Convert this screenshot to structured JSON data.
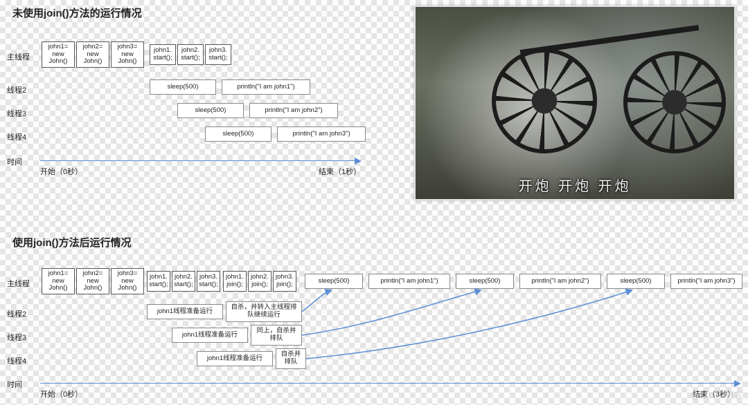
{
  "section1": {
    "title": "未使用join()方法的运行情况",
    "rows": [
      "主线程",
      "线程2",
      "线程3",
      "线程4",
      "时间"
    ],
    "main_boxes": [
      "john1=\nnew\nJohn()",
      "john2=\nnew\nJohn()",
      "john3=\nnew\nJohn()",
      "john1.\nstart();",
      "john2.\nstart();",
      "john3.\nstart();"
    ],
    "t2": {
      "sleep": "sleep(500)",
      "print": "println(\"I am john1\")"
    },
    "t3": {
      "sleep": "sleep(500)",
      "print": "println(\"I am john2\")"
    },
    "t4": {
      "sleep": "sleep(500)",
      "print": "println(\"I am john3\")"
    },
    "time_start": "开始（0秒）",
    "time_end": "结束（1秒）"
  },
  "photo": {
    "caption": "开炮 开炮 开炮"
  },
  "section2": {
    "title": "使用join()方法后运行情况",
    "rows": [
      "主线程",
      "线程2",
      "线程3",
      "线程4",
      "时间"
    ],
    "main_boxes": [
      "john1=\nnew\nJohn()",
      "john2=\nnew\nJohn()",
      "john3=\nnew\nJohn()",
      "john1.\nstart();",
      "john2.\nstart();",
      "john3.\nstart();",
      "john1.\njoin();",
      "john2.\njoin();",
      "john3.\njoin();"
    ],
    "main_tail": [
      "sleep(500)",
      "println(\"I am john1\")",
      "sleep(500)",
      "println(\"I am john2\")",
      "sleep(500)",
      "println(\"I am john3\")"
    ],
    "t2": {
      "prep": "john1线程准备运行",
      "note": "自杀，并转入主线程排\n队继续运行"
    },
    "t3": {
      "prep": "john1线程准备运行",
      "note": "同上，自杀并\n排队"
    },
    "t4": {
      "prep": "john1线程准备运行",
      "note": "自杀并\n排队"
    },
    "time_start": "开始（0秒）",
    "time_end": "结束（3秒）"
  },
  "watermark": "@51CTO博客"
}
